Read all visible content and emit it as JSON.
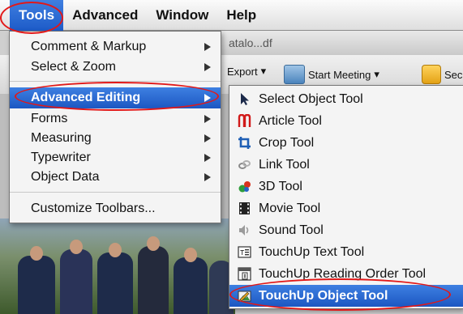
{
  "menubar": {
    "items": [
      {
        "label": "Tools"
      },
      {
        "label": "Advanced"
      },
      {
        "label": "Window"
      },
      {
        "label": "Help"
      }
    ]
  },
  "background": {
    "filename_fragment": "atalo...df",
    "toolbar": {
      "export_label": "Export",
      "meeting_label": "Start Meeting",
      "secure_label": "Secu"
    }
  },
  "tools_menu": {
    "items": [
      {
        "label": "Comment & Markup",
        "submenu": true
      },
      {
        "label": "Select & Zoom",
        "submenu": true
      },
      {
        "label": "Advanced Editing",
        "submenu": true,
        "selected": true
      },
      {
        "label": "Forms",
        "submenu": true
      },
      {
        "label": "Measuring",
        "submenu": true
      },
      {
        "label": "Typewriter",
        "submenu": true
      },
      {
        "label": "Object Data",
        "submenu": true
      },
      {
        "label": "Customize Toolbars...",
        "submenu": false
      }
    ]
  },
  "advanced_editing_submenu": {
    "items": [
      {
        "label": "Select Object Tool",
        "icon": "select-arrow-icon"
      },
      {
        "label": "Article Tool",
        "icon": "article-icon"
      },
      {
        "label": "Crop Tool",
        "icon": "crop-icon"
      },
      {
        "label": "Link Tool",
        "icon": "link-icon"
      },
      {
        "label": "3D Tool",
        "icon": "3d-icon"
      },
      {
        "label": "Movie Tool",
        "icon": "movie-icon"
      },
      {
        "label": "Sound Tool",
        "icon": "sound-icon"
      },
      {
        "label": "TouchUp Text Tool",
        "icon": "touchup-text-icon"
      },
      {
        "label": "TouchUp Reading Order Tool",
        "icon": "reading-order-icon"
      },
      {
        "label": "TouchUp Object Tool",
        "icon": "touchup-object-icon",
        "selected": true
      }
    ]
  },
  "colors": {
    "highlight": "#1d5bc8",
    "annotation": "#e21818"
  }
}
